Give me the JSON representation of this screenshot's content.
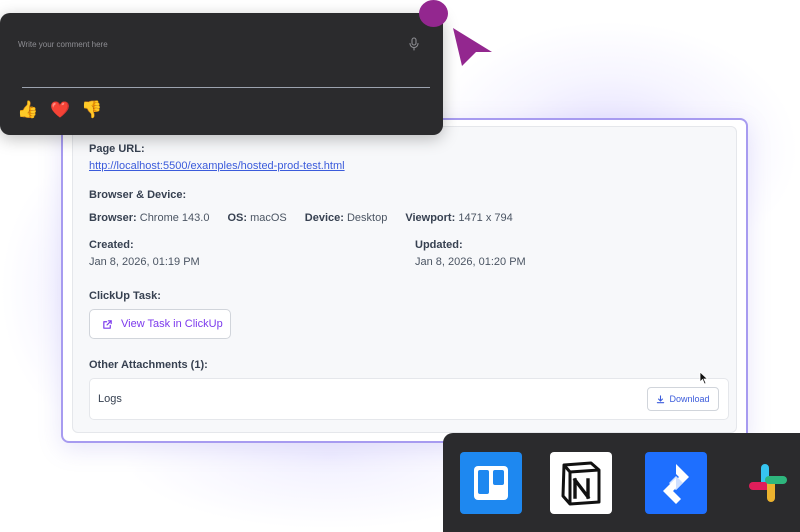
{
  "comment": {
    "placeholder": "Write your comment here",
    "reactions": [
      "👍",
      "❤️",
      "👎"
    ]
  },
  "details": {
    "page_url_label": "Page URL:",
    "page_url": "http://localhost:5500/examples/hosted-prod-test.html",
    "browser_device_label": "Browser & Device:",
    "browser_label": "Browser:",
    "browser_value": "Chrome 143.0",
    "os_label": "OS:",
    "os_value": "macOS",
    "device_label": "Device:",
    "device_value": "Desktop",
    "viewport_label": "Viewport:",
    "viewport_value": "1471 x 794",
    "created_label": "Created:",
    "created_value": "Jan 8, 2026, 01:19 PM",
    "updated_label": "Updated:",
    "updated_value": "Jan 8, 2026, 01:20 PM",
    "clickup_label": "ClickUp Task:",
    "clickup_button": "View Task in ClickUp",
    "attachments_label": "Other Attachments (1):",
    "attachments": [
      {
        "name": "Logs",
        "action": "Download"
      }
    ]
  },
  "integrations": [
    {
      "name": "trello",
      "icon": "trello-icon",
      "color": "#1e88f0"
    },
    {
      "name": "notion",
      "icon": "notion-icon",
      "color": "#ffffff"
    },
    {
      "name": "jira",
      "icon": "jira-icon",
      "color": "#1e6fff"
    },
    {
      "name": "slack",
      "icon": "slack-icon",
      "color": "#e01e5a"
    }
  ],
  "colors": {
    "accent": "#7c3aed",
    "link": "#3b5bdb",
    "card_border": "#a79bf0",
    "panel_dark": "#2b2b2d",
    "cursor_dot": "#93278f"
  }
}
